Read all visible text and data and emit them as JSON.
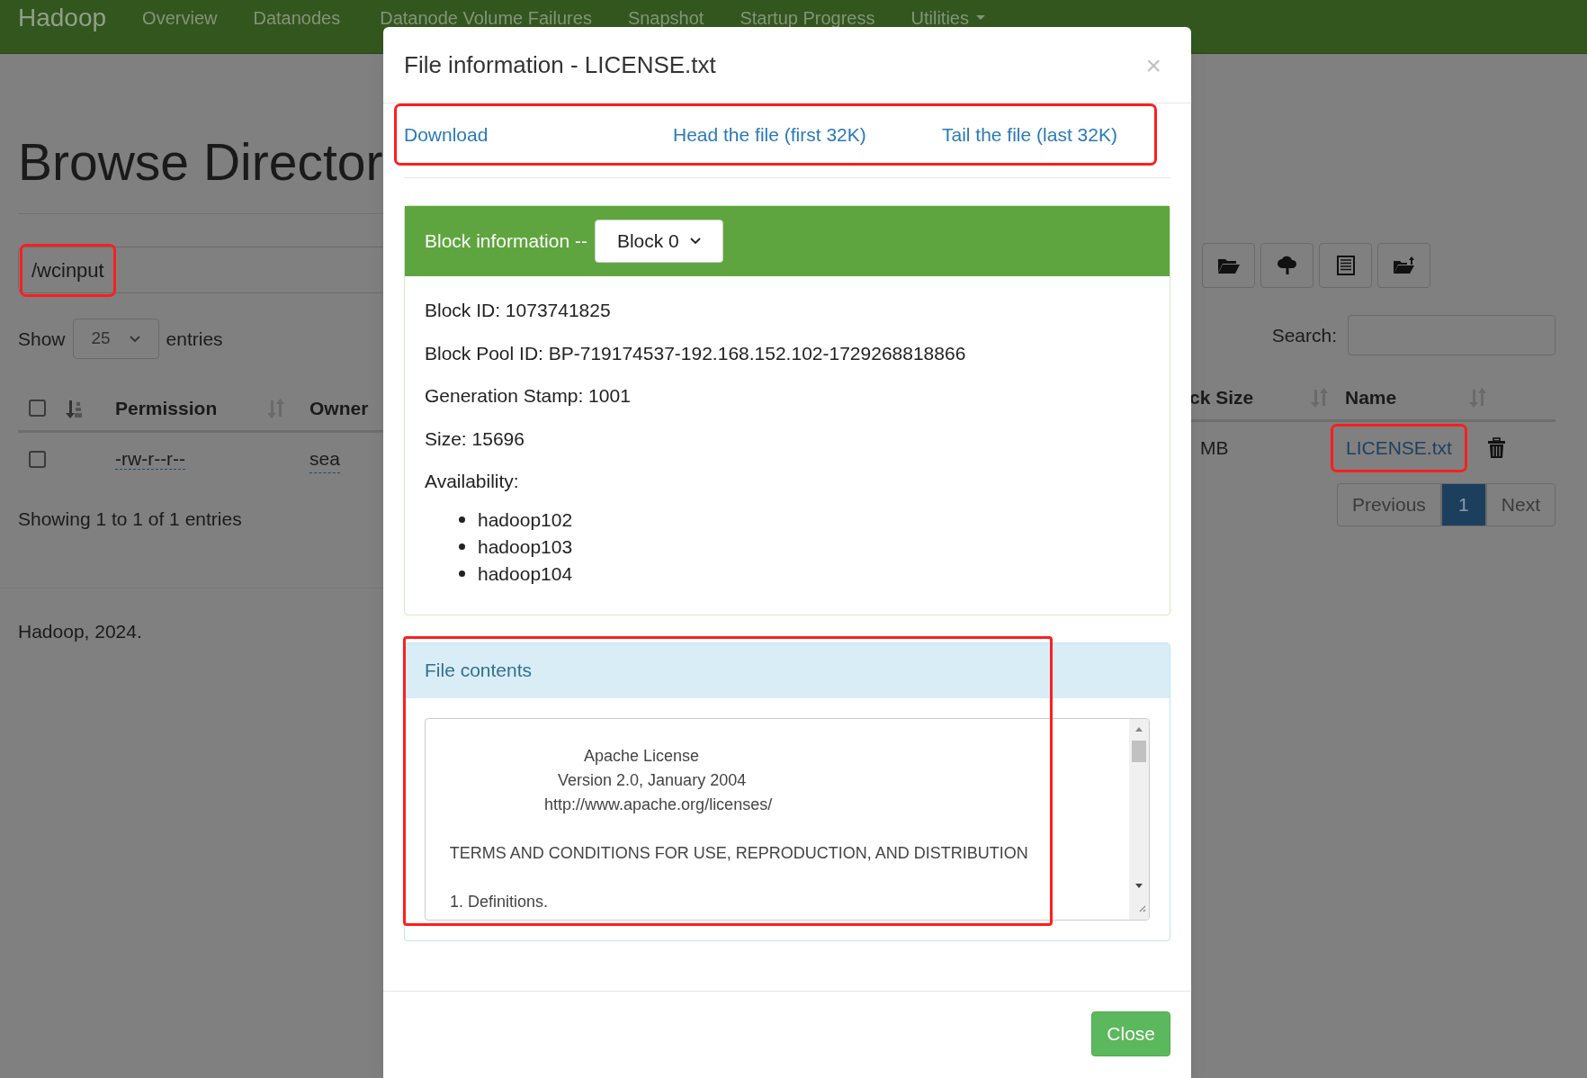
{
  "navbar": {
    "brand": "Hadoop",
    "items": [
      {
        "label": "Overview",
        "dropdown": false
      },
      {
        "label": "Datanodes",
        "dropdown": false
      },
      {
        "label": "Datanode Volume Failures",
        "dropdown": false
      },
      {
        "label": "Snapshot",
        "dropdown": false
      },
      {
        "label": "Startup Progress",
        "dropdown": false
      },
      {
        "label": "Utilities",
        "dropdown": true
      }
    ]
  },
  "page": {
    "title": "Browse Director",
    "path": {
      "value": "/wcinput",
      "highlighted": true
    },
    "toolbar": [
      {
        "kind": "folder"
      },
      {
        "kind": "upload"
      },
      {
        "kind": "list"
      },
      {
        "kind": "folder-upload"
      }
    ],
    "length": {
      "before": "Show",
      "value": "25",
      "after": "entries"
    },
    "search_label": "Search:",
    "header_checked": false,
    "columns_left": [
      "Permission",
      "Owner"
    ],
    "columns_right": [
      "ck Size",
      "Name"
    ],
    "rows": [
      {
        "checked": false,
        "permission": "-rw-r--r--",
        "owner": "sea",
        "block_size": "MB",
        "name": "LICENSE.txt",
        "name_highlighted": true
      }
    ],
    "info": "Showing 1 to 1 of 1 entries",
    "pagination": [
      {
        "label": "Previous",
        "selected": false
      },
      {
        "label": "1",
        "selected": true
      },
      {
        "label": "Next",
        "selected": false
      }
    ],
    "footer": "Hadoop, 2024."
  },
  "modal": {
    "title": "File information - LICENSE.txt",
    "close": "×",
    "links": [
      "Download",
      "Head the file (first 32K)",
      "Tail the file (last 32K)"
    ],
    "links_highlighted": true,
    "block": {
      "title": "Block information --",
      "select": "Block 0",
      "details": [
        "Block ID: 1073741825",
        "Block Pool ID: BP-719174537-192.168.152.102-1729268818866",
        "Generation Stamp: 1001",
        "Size: 15696"
      ],
      "availability_label": "Availability:",
      "availability": [
        "hadoop102",
        "hadoop103",
        "hadoop104"
      ]
    },
    "file_contents": {
      "title": "File contents",
      "highlighted": true,
      "text": "                                 Apache License\n                           Version 2.0, January 2004\n                        http://www.apache.org/licenses/\n\n   TERMS AND CONDITIONS FOR USE, REPRODUCTION, AND DISTRIBUTION\n\n   1. Definitions."
    },
    "close_button": "Close"
  }
}
